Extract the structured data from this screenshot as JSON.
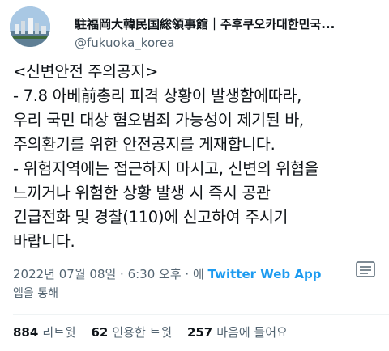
{
  "account": {
    "display_name": "駐福岡大韓民国総領事館｜주후쿠오카대한민국...",
    "handle": "@fukuoka_korea"
  },
  "tweet": {
    "lines": [
      "<신변안전 주의공지>",
      "- 7.8 아베前총리 피격 상황이 발생함에따라,",
      "우리 국민 대상 혐오범죄 가능성이 제기된 바,",
      "주의환기를 위한 안전공지를 게재합니다.",
      "- 위험지역에는 접근하지 마시고, 신변의 위협을",
      "느끼거나 위험한 상황 발생 시 즉시 공관",
      "긴급전화 및 경찰(110)에 신고하여 주시기",
      "바랍니다."
    ]
  },
  "meta": {
    "timestamp": "2022년 07월 08일 · 6:30 오후 · 에",
    "source": "Twitter Web App",
    "via": "앱을 통해"
  },
  "stats": {
    "retweets_count": "884",
    "retweets_label": "리트윗",
    "quotes_count": "62",
    "quotes_label": "인용한 트윗",
    "likes_count": "257",
    "likes_label": "마음에 들어요"
  }
}
